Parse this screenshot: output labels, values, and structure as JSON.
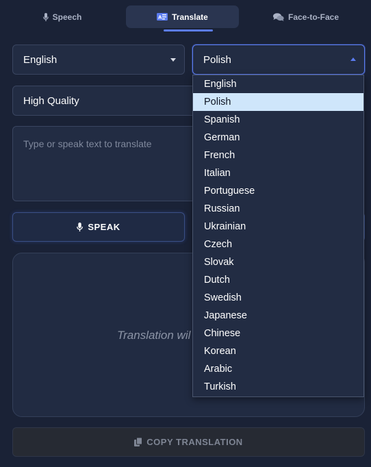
{
  "tabs": [
    {
      "label": "Speech",
      "icon": "microphone-icon"
    },
    {
      "label": "Translate",
      "icon": "translate-icon"
    },
    {
      "label": "Face-to-Face",
      "icon": "comments-icon"
    }
  ],
  "active_tab": "Translate",
  "source_language": {
    "value": "English"
  },
  "target_language": {
    "value": "Polish"
  },
  "quality": {
    "value": "High Quality"
  },
  "input": {
    "placeholder": "Type or speak text to translate"
  },
  "speak_button": {
    "label": "SPEAK"
  },
  "output": {
    "placeholder": "Translation wil"
  },
  "copy_button": {
    "label": "COPY TRANSLATION"
  },
  "dropdown": {
    "selected": "Polish",
    "options": [
      "English",
      "Polish",
      "Spanish",
      "German",
      "French",
      "Italian",
      "Portuguese",
      "Russian",
      "Ukrainian",
      "Czech",
      "Slovak",
      "Dutch",
      "Swedish",
      "Japanese",
      "Chinese",
      "Korean",
      "Arabic",
      "Turkish"
    ]
  },
  "colors": {
    "accent": "#5b7cf0",
    "background": "#1a2236",
    "selected_option": "#cfe6fb"
  }
}
